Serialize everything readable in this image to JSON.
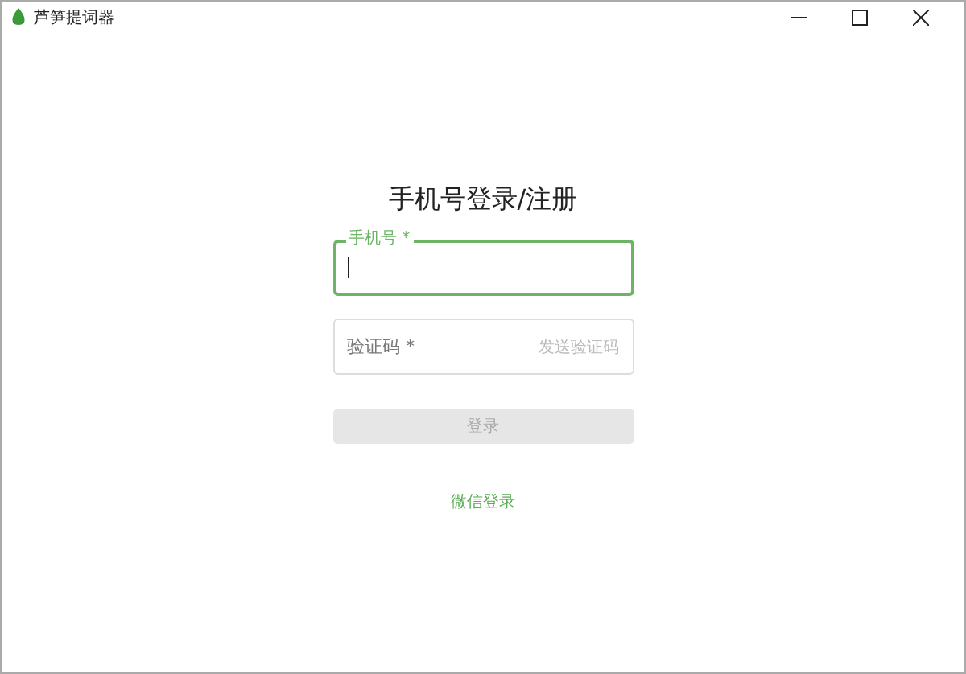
{
  "window": {
    "title": "芦笋提词器"
  },
  "heading": "手机号登录/注册",
  "phone_field": {
    "label": "手机号 *",
    "focused": true
  },
  "code_field": {
    "placeholder": "验证码 *",
    "send_code": "发送验证码"
  },
  "login_button": {
    "label": "登录",
    "disabled": true
  },
  "wechat_login": "微信登录"
}
